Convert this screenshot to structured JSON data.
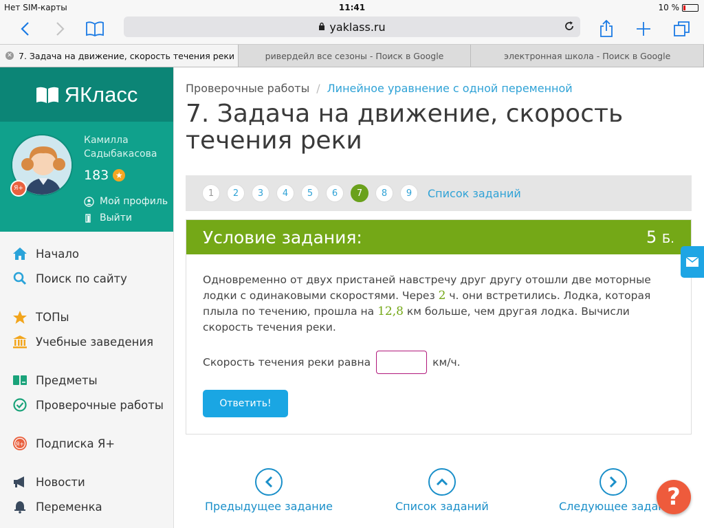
{
  "status_bar": {
    "carrier": "Нет SIM-карты",
    "time": "11:41",
    "battery": "10 %"
  },
  "browser": {
    "url": "yaklass.ru"
  },
  "tabs": [
    {
      "label": "7. Задача на движение, скорость течения реки"
    },
    {
      "label": "ривердейл все сезоны - Поиск в Google"
    },
    {
      "label": "электронная школа - Поиск в Google"
    }
  ],
  "sidebar": {
    "brand": "ЯКласс",
    "user": {
      "first_name": "Камилла",
      "last_name": "Садыбакасова",
      "points": "183",
      "badge": "Я+"
    },
    "profile_link": "Мой профиль",
    "logout_link": "Выйти",
    "items": [
      {
        "label": "Начало",
        "icon": "home-icon"
      },
      {
        "label": "Поиск по сайту",
        "icon": "search-icon"
      },
      {
        "label": "ТОПы",
        "icon": "star-icon"
      },
      {
        "label": "Учебные заведения",
        "icon": "institution-icon"
      },
      {
        "label": "Предметы",
        "icon": "books-icon"
      },
      {
        "label": "Проверочные работы",
        "icon": "check-circle-icon"
      },
      {
        "label": "Подписка Я+",
        "icon": "ya-plus-icon"
      },
      {
        "label": "Новости",
        "icon": "megaphone-icon"
      },
      {
        "label": "Переменка",
        "icon": "bell-icon"
      }
    ]
  },
  "breadcrumb": {
    "root": "Проверочные работы",
    "current": "Линейное уравнение с одной переменной"
  },
  "page_title": "7. Задача на движение, скорость течения реки",
  "pager": {
    "pages": [
      "1",
      "2",
      "3",
      "4",
      "5",
      "6",
      "7",
      "8",
      "9"
    ],
    "active": "7",
    "list_label": "Список заданий"
  },
  "task": {
    "header": "Условие задания:",
    "points": "5",
    "points_unit": "Б.",
    "text_part1": "Одновременно от двух пристаней навстречу друг другу отошли две моторные лодки с одинаковыми скоростями. Через ",
    "num1": "2",
    "text_part2": " ч. они встретились. Лодка, которая плыла по течению, прошла на ",
    "num2": "12,8",
    "text_part3": " км больше, чем другая лодка. Вычисли скорость течения реки.",
    "answer_prefix": "Скорость течения реки равна",
    "answer_suffix": "км/ч.",
    "submit": "Ответить!"
  },
  "bottom_nav": {
    "prev": "Предыдущее задание",
    "list": "Список заданий",
    "next": "Следующее задание"
  },
  "help": "?",
  "colors": {
    "brand_dark": "#0c8576",
    "brand": "#10a18c",
    "task_header": "#74a817",
    "link": "#2fa2d6",
    "button": "#1aa6e3"
  }
}
